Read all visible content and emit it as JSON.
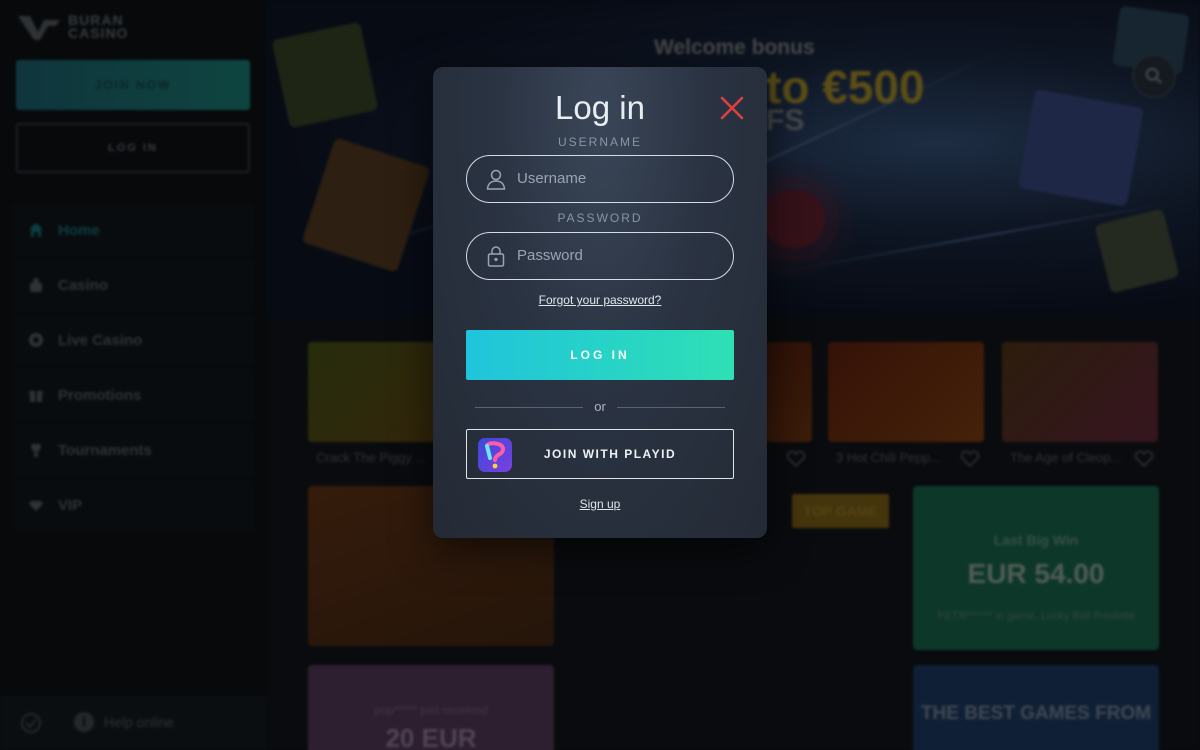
{
  "brand": {
    "logo_line1": "BURAN",
    "logo_line2": "CASINO"
  },
  "sidebar": {
    "join_label": "JOIN NOW",
    "login_label": "LOG IN",
    "items": [
      {
        "label": "Home",
        "icon": "home-icon",
        "active": true
      },
      {
        "label": "Casino",
        "icon": "casino-icon",
        "active": false
      },
      {
        "label": "Live Casino",
        "icon": "live-casino-icon",
        "active": false
      },
      {
        "label": "Promotions",
        "icon": "gift-icon",
        "active": false
      },
      {
        "label": "Tournaments",
        "icon": "trophy-icon",
        "active": false
      },
      {
        "label": "VIP",
        "icon": "diamond-icon",
        "active": false
      }
    ],
    "help_label": "Help online"
  },
  "hero": {
    "title": "Welcome bonus",
    "amount": "to €500",
    "sub": "FS"
  },
  "games": {
    "labels": [
      "Crack The Piggy ...",
      "3 Hot Chili Pepp...",
      "The Age of Cleop..."
    ],
    "top_game_badge": "TOP GAME",
    "last_win_title": "Last Big Win",
    "last_win_amount": "EUR 54.00",
    "last_win_detail": "PETR****** in game, Lucky Ball Roulette",
    "promo_text": "pop***** just received",
    "promo_amount": "20 EUR",
    "best_games_text": "THE BEST GAMES FROM"
  },
  "modal": {
    "title": "Log in",
    "username_label": "USERNAME",
    "username_placeholder": "Username",
    "password_label": "PASSWORD",
    "password_placeholder": "Password",
    "forgot_label": "Forgot your password?",
    "login_button": "LOG IN",
    "or_label": "or",
    "playid_button": "JOIN WITH PLAYID",
    "signup_label": "Sign up"
  },
  "colors": {
    "accent_start": "#20c4dc",
    "accent_end": "#2ee0b4",
    "close": "#e04040",
    "modal_bg": "#2a3342"
  }
}
